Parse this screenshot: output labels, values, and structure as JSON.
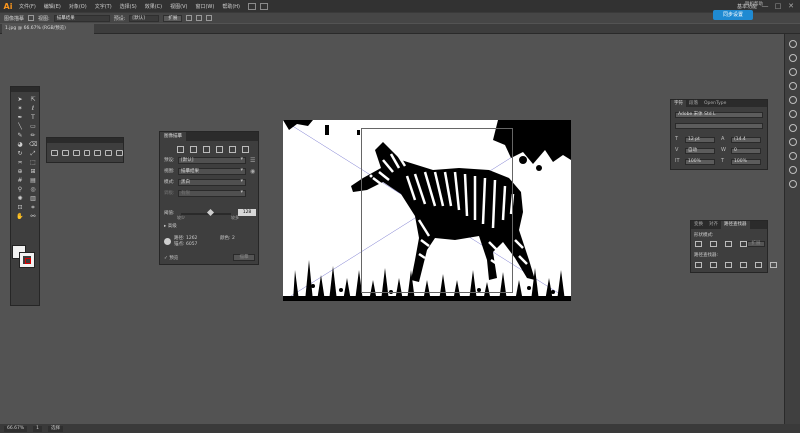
{
  "app": {
    "logo": "Ai"
  },
  "menubar": {
    "items": [
      "文件(F)",
      "编辑(E)",
      "对象(O)",
      "文字(T)",
      "选择(S)",
      "效果(C)",
      "视图(V)",
      "窗口(W)",
      "帮助(H)"
    ],
    "workspace": "基本功能",
    "window_buttons": [
      "—",
      "□",
      "✕"
    ]
  },
  "controlbar": {
    "label": "图像描摹",
    "view_label": "视图:",
    "view_value": "描摹结果",
    "preset_label": "预设:",
    "preset_value": "[默认]",
    "expand_label": "扩展",
    "cloud_button": "同步设置",
    "cloud_sub": "联机帮助"
  },
  "document": {
    "tab": "1.jpg @ 66.67% (RGB/预览)"
  },
  "statusbar": {
    "zoom": "66.67%",
    "page": "1",
    "tool": "选择"
  },
  "image_trace": {
    "title": "图像描摹",
    "preset_label": "预设:",
    "preset_value": "[默认]",
    "view_label": "视图:",
    "view_value": "描摹结果",
    "mode_label": "模式:",
    "mode_value": "黑白",
    "palette_label": "调板:",
    "palette_value": "有限",
    "threshold_label": "阈值:",
    "threshold_value": "128",
    "less_label": "较少",
    "more_label": "较多",
    "advanced_label": "▸ 高级",
    "paths_label": "路径:",
    "paths_value": "1262",
    "anchors_label": "锚点:",
    "anchors_value": "6057",
    "colors_label": "颜色:",
    "colors_value": "2",
    "preview_label": "✓ 预览",
    "trace_button": "描摹"
  },
  "character_panel": {
    "tabs": [
      "字符",
      "段落",
      "OpenType"
    ],
    "font_value": "Adobe 宋体 Std L",
    "style_value": "",
    "size_value": "12 pt",
    "leading_value": "(14.4",
    "kerning_value": "自动",
    "tracking_value": "0",
    "scale_v_value": "100%",
    "scale_h_value": "100%"
  },
  "pathfinder_panel": {
    "tabs": [
      "变换",
      "对齐",
      "路径查找器"
    ],
    "shape_modes_label": "形状模式:",
    "pathfinders_label": "路径查找器:",
    "expand_button": "扩展"
  },
  "colors": {
    "accent": "#1f8ad2",
    "logo": "#f7941d",
    "panel_bg": "#3e3e3e",
    "canvas_bg": "#535353"
  }
}
